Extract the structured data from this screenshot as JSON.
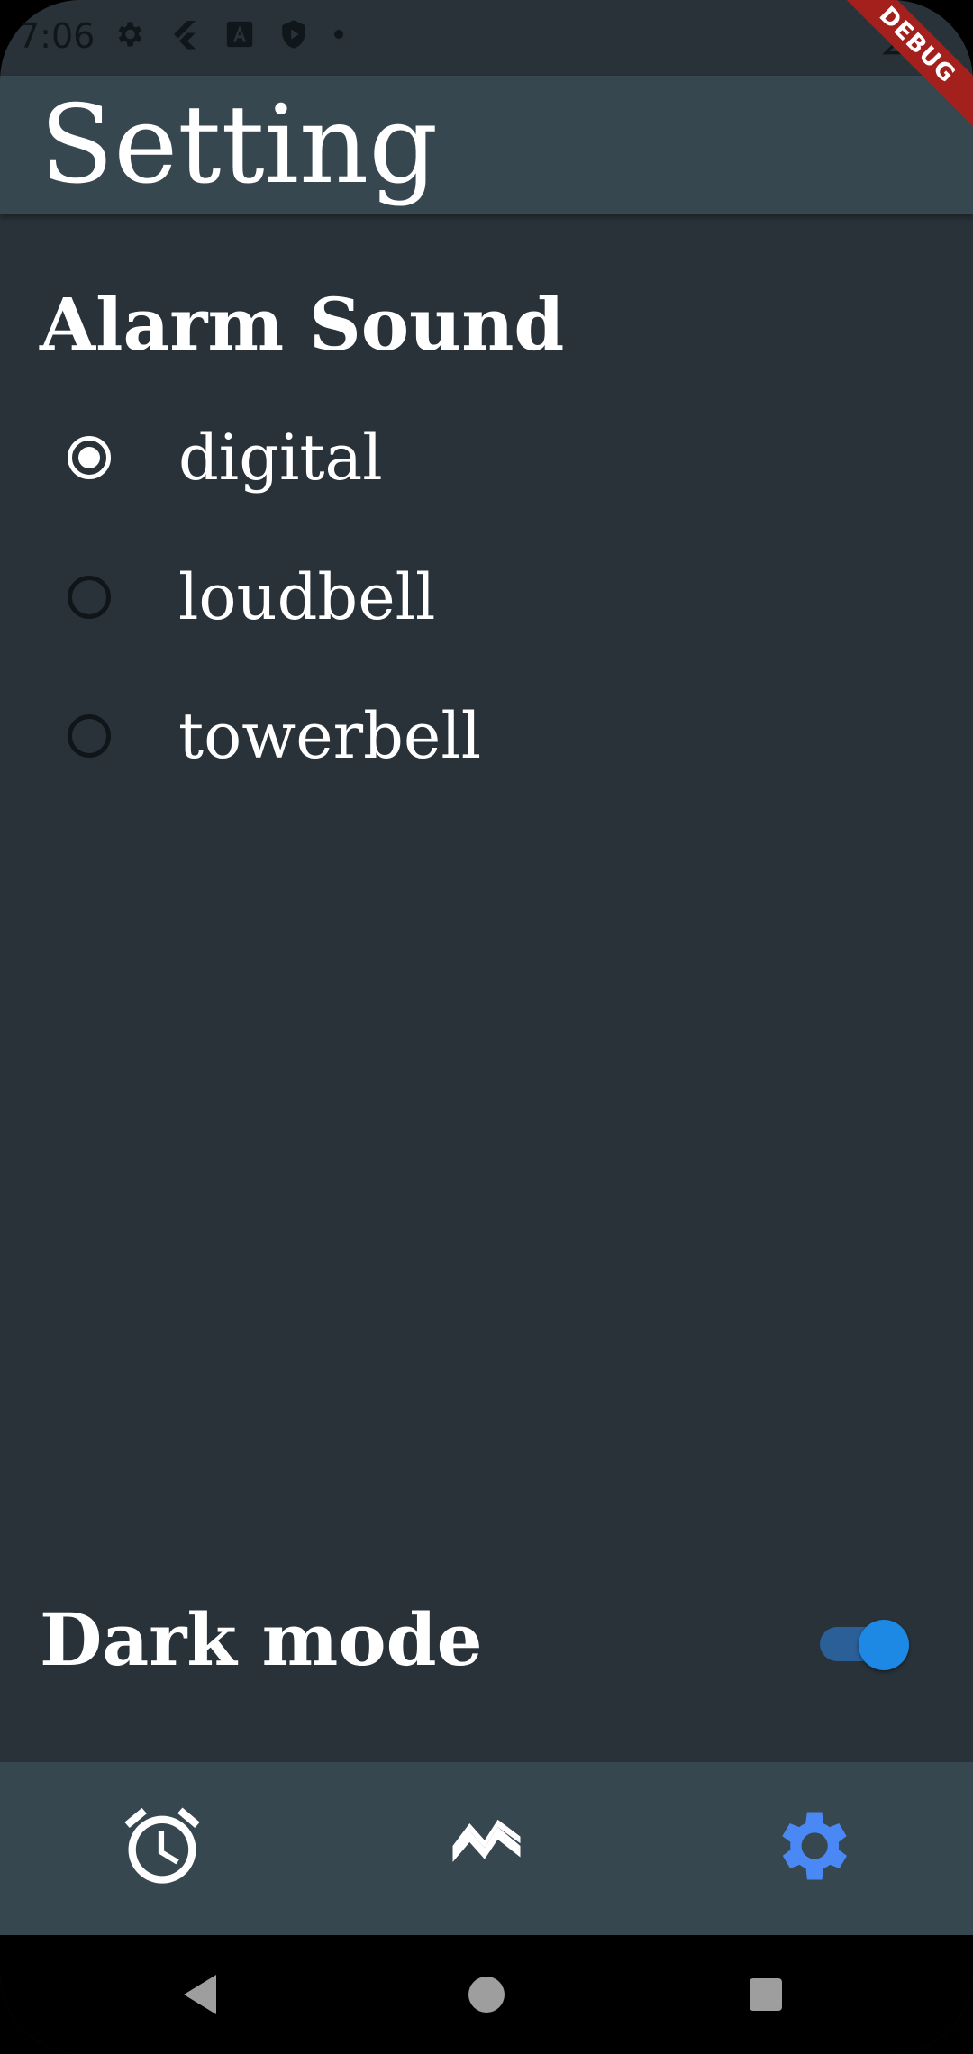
{
  "status_bar": {
    "time": "7:06",
    "icons": [
      "settings-gear-icon",
      "flutter-icon",
      "a-box-icon",
      "shield-play-icon",
      "dot-icon"
    ],
    "right_icons": [
      "signal-icon"
    ]
  },
  "debug_banner": "DEBUG",
  "app_bar": {
    "title": "Setting"
  },
  "alarm_sound": {
    "title": "Alarm Sound",
    "options": [
      {
        "label": "digital",
        "selected": true
      },
      {
        "label": "loudbell",
        "selected": false
      },
      {
        "label": "towerbell",
        "selected": false
      }
    ]
  },
  "dark_mode": {
    "label": "Dark mode",
    "enabled": true
  },
  "bottom_nav": {
    "items": [
      {
        "icon": "alarm-clock-icon",
        "active": false
      },
      {
        "icon": "chart-icon",
        "active": false
      },
      {
        "icon": "settings-gear-icon",
        "active": true
      }
    ],
    "active_color": "#4a89f5",
    "inactive_color": "#ffffff"
  },
  "colors": {
    "background": "#283238",
    "app_bar": "#37474f",
    "switch_thumb": "#1e88e5",
    "switch_track": "#2a5f97",
    "debug_banner": "#a3201d"
  }
}
